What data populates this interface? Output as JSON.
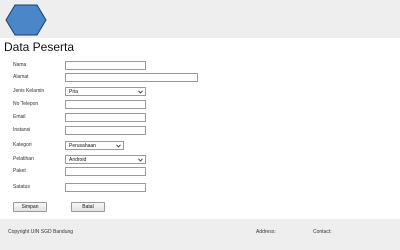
{
  "page_title": "Data Peserta",
  "form": {
    "nama": {
      "label": "Nama",
      "value": ""
    },
    "alamat": {
      "label": "Alamat",
      "value": ""
    },
    "jenis_kelamin": {
      "label": "Jenis Kelamin",
      "selected": "Pria"
    },
    "no_telepon": {
      "label": "No Telepon",
      "value": ""
    },
    "email": {
      "label": "Email",
      "value": ""
    },
    "instansi": {
      "label": "Instansi",
      "value": ""
    },
    "kategori": {
      "label": "Kategori",
      "selected": "Perusahaan"
    },
    "pelatihan": {
      "label": "Pelatihan",
      "selected": "Android"
    },
    "paket": {
      "label": "Paket",
      "value": ""
    },
    "status": {
      "label": "Satatus",
      "value": ""
    }
  },
  "buttons": {
    "simpan": "Simpan",
    "batal": "Batal"
  },
  "footer": {
    "copyright": "Copyright UIN SGD Bandung",
    "address": "Address:",
    "contact": "Contact:"
  },
  "colors": {
    "header_bg": "#eeeeee",
    "footer_bg": "#eeeeee",
    "logo_fill": "#4a86c8",
    "logo_stroke": "#1a3f6e"
  },
  "icons": {
    "logo": "hexagon-logo-icon",
    "dropdown": "chevron-down-icon"
  }
}
